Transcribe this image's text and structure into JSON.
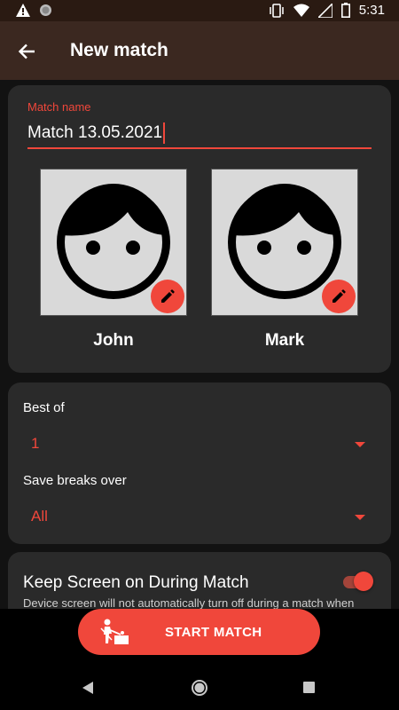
{
  "status_bar": {
    "time": "5:31",
    "left_icons": [
      "warning-icon",
      "circle-notification-icon"
    ],
    "right_icons": [
      "vibrate-icon",
      "wifi-icon",
      "signal-icon",
      "battery-icon"
    ]
  },
  "app_bar": {
    "title": "New match",
    "back_icon": "arrow-back-icon"
  },
  "match": {
    "label": "Match name",
    "value": "Match 13.05.2021"
  },
  "players": [
    {
      "name": "John",
      "avatar_icon": "face-icon",
      "edit_icon": "pencil-icon"
    },
    {
      "name": "Mark",
      "avatar_icon": "face-icon",
      "edit_icon": "pencil-icon"
    }
  ],
  "settings": {
    "best_of_label": "Best of",
    "best_of_value": "1",
    "save_breaks_label": "Save breaks over",
    "save_breaks_value": "All"
  },
  "keep_screen": {
    "title": "Keep Screen on During Match",
    "description": "Device screen will not automatically turn off during a match when",
    "enabled": true
  },
  "start_button": {
    "label": "START MATCH",
    "icon": "snooker-player-icon"
  },
  "colors": {
    "accent": "#f0473b",
    "app_bar": "#3b2820",
    "status_bar": "#2a1a12",
    "card": "#2a2a2a",
    "background": "#121212"
  },
  "nav": [
    "nav-back-icon",
    "nav-home-icon",
    "nav-recents-icon"
  ]
}
